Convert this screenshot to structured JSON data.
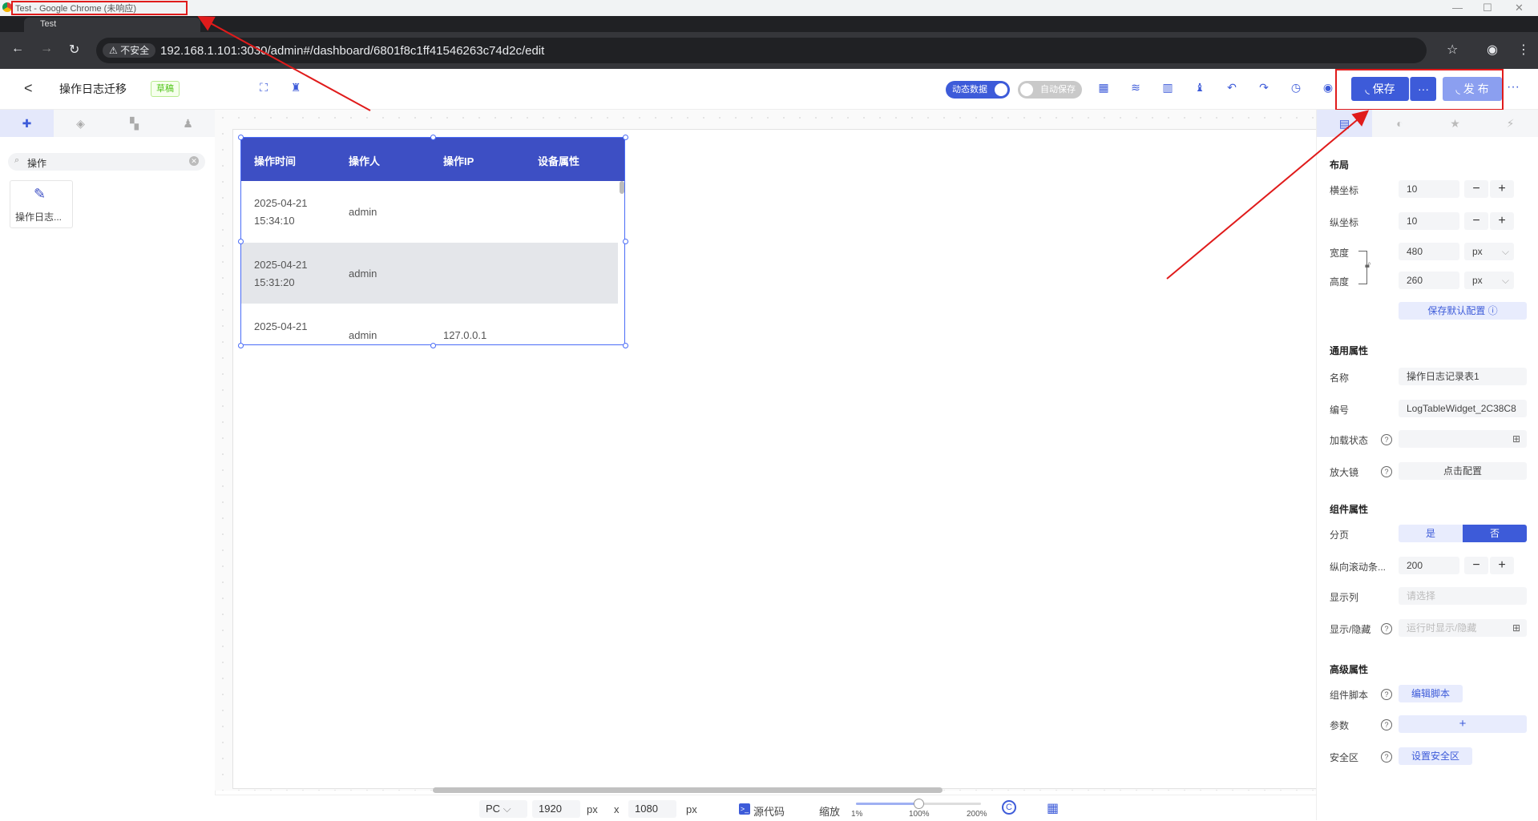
{
  "browser": {
    "window_title": "Test - Google Chrome (未响应)",
    "tab_label": "Test",
    "security_badge": "不安全",
    "url": "192.168.1.101:3030/admin#/dashboard/6801f8c1ff41546263c74d2c/edit"
  },
  "header": {
    "page_title": "操作日志迁移",
    "draft_badge": "草稿",
    "dynamic_data_label": "动态数据",
    "auto_save_label": "自动保存",
    "save_label": "保存",
    "more_label": "···",
    "publish_label": "发 布",
    "overflow_label": "···"
  },
  "left_panel": {
    "search_value": "操作",
    "component_card_label": "操作日志..."
  },
  "table_widget": {
    "headers": [
      "操作时间",
      "操作人",
      "操作IP",
      "设备属性"
    ],
    "rows": [
      {
        "time_date": "2025-04-21",
        "time_clock": "15:34:10",
        "user": "admin",
        "ip": "",
        "device": ""
      },
      {
        "time_date": "2025-04-21",
        "time_clock": "15:31:20",
        "user": "admin",
        "ip": "",
        "device": ""
      },
      {
        "time_date": "2025-04-21",
        "time_clock": "",
        "user": "admin",
        "ip": "127.0.0.1",
        "device": ""
      }
    ]
  },
  "right_panel": {
    "layout": {
      "section": "布局",
      "x_label": "横坐标",
      "x_value": "10",
      "y_label": "纵坐标",
      "y_value": "10",
      "width_label": "宽度",
      "width_value": "480",
      "width_unit": "px",
      "height_label": "高度",
      "height_value": "260",
      "height_unit": "px",
      "save_default_label": "保存默认配置"
    },
    "general": {
      "section": "通用属性",
      "name_label": "名称",
      "name_value": "操作日志记录表1",
      "id_label": "编号",
      "id_value": "LogTableWidget_2C38C8",
      "loading_label": "加载状态",
      "magnifier_label": "放大镜",
      "magnifier_button": "点击配置"
    },
    "component": {
      "section": "组件属性",
      "paging_label": "分页",
      "paging_yes": "是",
      "paging_no": "否",
      "vscroll_label": "纵向滚动条...",
      "vscroll_value": "200",
      "columns_label": "显示列",
      "columns_placeholder": "请选择",
      "visibility_label": "显示/隐藏",
      "visibility_placeholder": "运行时显示/隐藏"
    },
    "advanced": {
      "section": "高级属性",
      "script_label": "组件脚本",
      "script_button": "编辑脚本",
      "params_label": "参数",
      "params_button": "+",
      "safezone_label": "安全区",
      "safezone_button": "设置安全区"
    }
  },
  "bottom_bar": {
    "device": "PC",
    "width": "1920",
    "width_unit": "px",
    "times": "x",
    "height": "1080",
    "height_unit": "px",
    "source_code_label": "源代码",
    "zoom_label": "缩放",
    "zoom_min": "1%",
    "zoom_mid": "100%",
    "zoom_max": "200%",
    "zoom_fraction": 0.5
  },
  "colors": {
    "accent": "#3d5bd9",
    "table_header": "#3d4fc4",
    "annotation": "#e01b1b"
  }
}
